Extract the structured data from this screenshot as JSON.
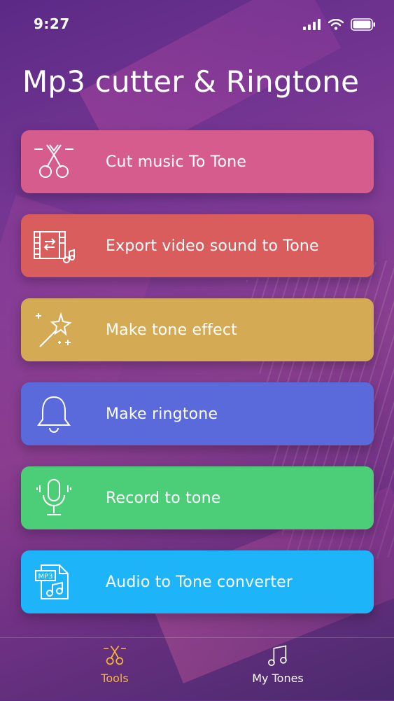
{
  "status_bar": {
    "time": "9:27",
    "icons": [
      "signal-icon",
      "wifi-icon",
      "battery-icon"
    ]
  },
  "app": {
    "title": "Mp3 cutter & Ringtone"
  },
  "menu": {
    "items": [
      {
        "label": "Cut music To Tone",
        "icon": "scissors-icon",
        "color": "#D55C8D"
      },
      {
        "label": "Export video sound to Tone",
        "icon": "video-music-icon",
        "color": "#D95D5D"
      },
      {
        "label": "Make tone effect",
        "icon": "magic-wand-icon",
        "color": "#D5AA55"
      },
      {
        "label": "Make ringtone",
        "icon": "bell-icon",
        "color": "#5A6ADB"
      },
      {
        "label": "Record to tone",
        "icon": "microphone-icon",
        "color": "#4CCD77"
      },
      {
        "label": "Audio to Tone converter",
        "icon": "mp3-file-icon",
        "color": "#1EB4FA"
      }
    ]
  },
  "tabbar": {
    "tabs": [
      {
        "label": "Tools",
        "icon": "scissors-icon",
        "active": true
      },
      {
        "label": "My Tones",
        "icon": "music-note-icon",
        "active": false
      }
    ],
    "active_color": "#F7B731"
  }
}
